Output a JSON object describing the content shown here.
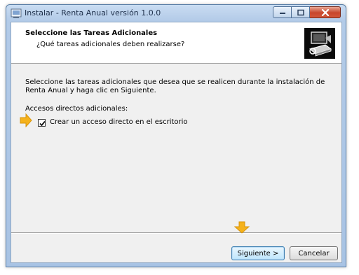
{
  "window": {
    "title": "Instalar - Renta Anual versión 1.0.0"
  },
  "header": {
    "title": "Seleccione las Tareas Adicionales",
    "subtitle": "¿Qué tareas adicionales deben realizarse?"
  },
  "content": {
    "description": "Seleccione las tareas adicionales que desea que se realicen durante la instalación de Renta Anual y haga clic en Siguiente.",
    "section_label": "Accesos directos adicionales:",
    "tasks": [
      {
        "label": "Crear un acceso directo en el escritorio",
        "checked": true
      }
    ]
  },
  "buttons": {
    "next": "Siguiente >",
    "cancel": "Cancelar"
  },
  "colors": {
    "arrow": "#f5b21b",
    "title_bar": "#b3cbe8",
    "close_button": "#c7462c"
  },
  "icons": [
    "installer-app-icon",
    "minimize-icon",
    "maximize-icon",
    "close-icon",
    "installer-logo-icon",
    "arrow-right-icon",
    "arrow-down-icon",
    "checkmark-icon"
  ]
}
